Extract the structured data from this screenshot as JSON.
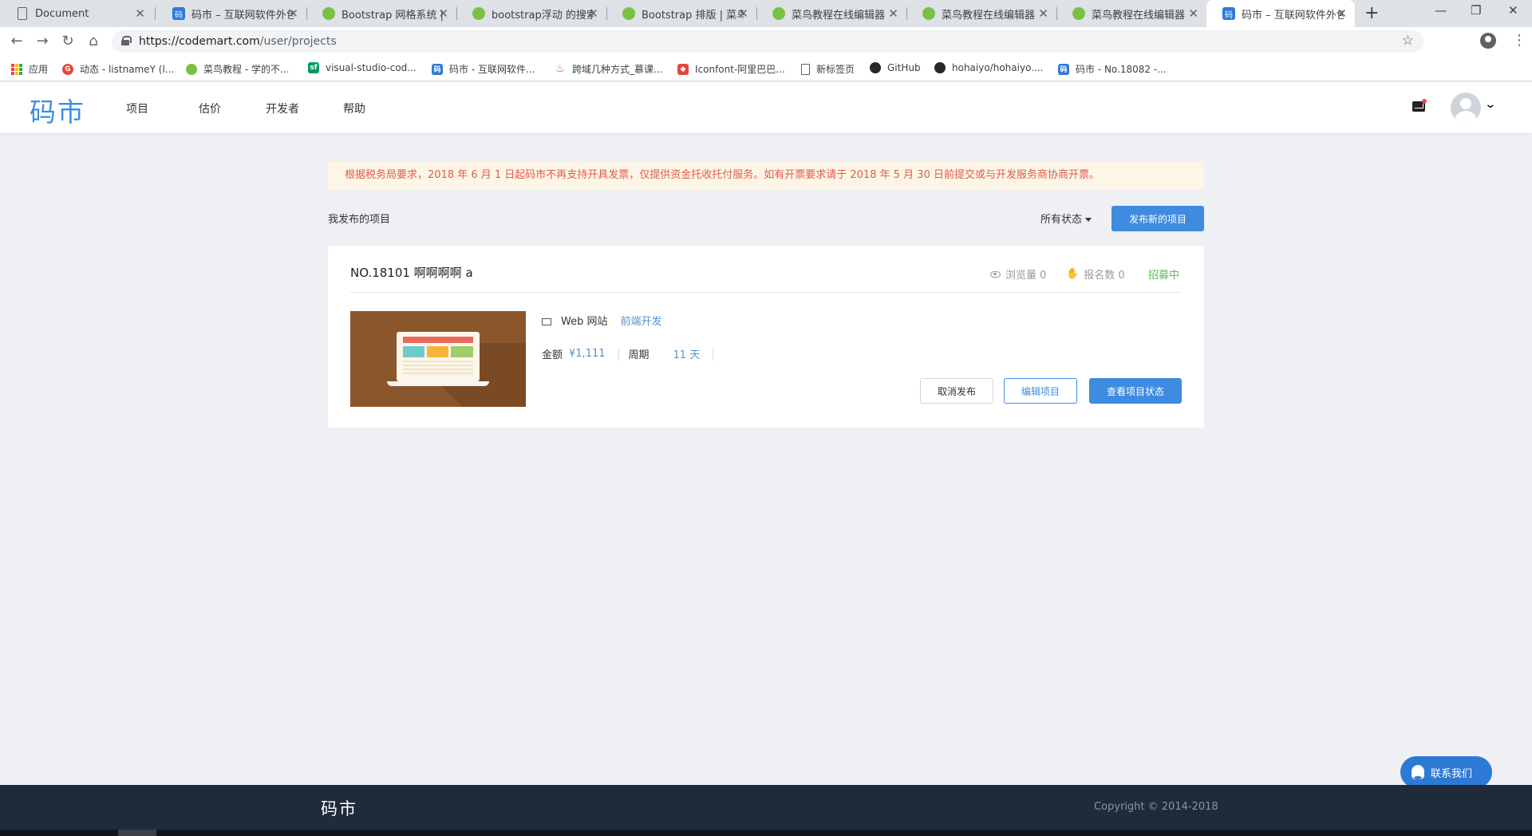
{
  "browser": {
    "tabs": [
      {
        "title": "Document",
        "icon": "document-icon"
      },
      {
        "title": "码市 – 互联网软件外包",
        "icon": "codemart-icon"
      },
      {
        "title": "Bootstrap 网格系统 | 菜",
        "icon": "runoob-icon"
      },
      {
        "title": "bootstrap浮动 的搜索",
        "icon": "runoob-icon"
      },
      {
        "title": "Bootstrap 排版 | 菜鸟",
        "icon": "runoob-icon"
      },
      {
        "title": "菜鸟教程在线编辑器",
        "icon": "runoob-icon"
      },
      {
        "title": "菜鸟教程在线编辑器",
        "icon": "runoob-icon"
      },
      {
        "title": "菜鸟教程在线编辑器",
        "icon": "runoob-icon"
      },
      {
        "title": "码市 – 互联网软件外包",
        "icon": "codemart-icon",
        "active": true
      }
    ],
    "url_host": "https://codemart.com",
    "url_path": "/user/projects",
    "bookmarks": [
      {
        "label": "应用",
        "icon": "apps-icon"
      },
      {
        "label": "动态 - listnameY (l...",
        "icon": "g-icon"
      },
      {
        "label": "菜鸟教程 - 学的不...",
        "icon": "runoob-icon"
      },
      {
        "label": "visual-studio-cod...",
        "icon": "sf-icon"
      },
      {
        "label": "码市 - 互联网软件...",
        "icon": "codemart-icon"
      },
      {
        "label": "跨域几种方式_慕课...",
        "icon": "fire-icon"
      },
      {
        "label": "Iconfont-阿里巴巴...",
        "icon": "iconfont-icon"
      },
      {
        "label": "新标签页",
        "icon": "page-icon"
      },
      {
        "label": "GitHub",
        "icon": "github-icon"
      },
      {
        "label": "hohaiyo/hohaiyo....",
        "icon": "github-icon"
      },
      {
        "label": "码市 - No.18082 -...",
        "icon": "codemart-icon"
      }
    ]
  },
  "site": {
    "logo": "码市",
    "nav": [
      "项目",
      "估价",
      "开发者",
      "帮助"
    ]
  },
  "notice": "根据税务局要求，2018 年 6 月 1 日起码市不再支持开具发票，仅提供资金托收托付服务。如有开票要求请于 2018 年 5 月 30 日前提交或与开发服务商协商开票。",
  "projects_header": {
    "title": "我发布的项目",
    "filter": "所有状态",
    "publish_label": "发布新的项目"
  },
  "project": {
    "title": "NO.18101  啊啊啊啊 a",
    "views": "浏览量 0",
    "signups": "报名数 0",
    "status": "招募中",
    "type": "Web 网站",
    "tag": "前端开发",
    "amount_label": "金额",
    "amount": "¥1,111",
    "period_label": "周期",
    "period": "11 天",
    "cancel_label": "取消发布",
    "edit_label": "编辑项目",
    "view_status_label": "查看项目状态"
  },
  "contact_label": "联系我们",
  "footer": {
    "logo": "码市",
    "copyright": "Copyright © 2014-2018"
  },
  "colors": {
    "brand": "#3a8ee6",
    "primary_button": "#3e8be0",
    "notice_text": "#e05b4b",
    "status_green": "#5cb85c",
    "footer_bg": "#1f2b3a"
  }
}
